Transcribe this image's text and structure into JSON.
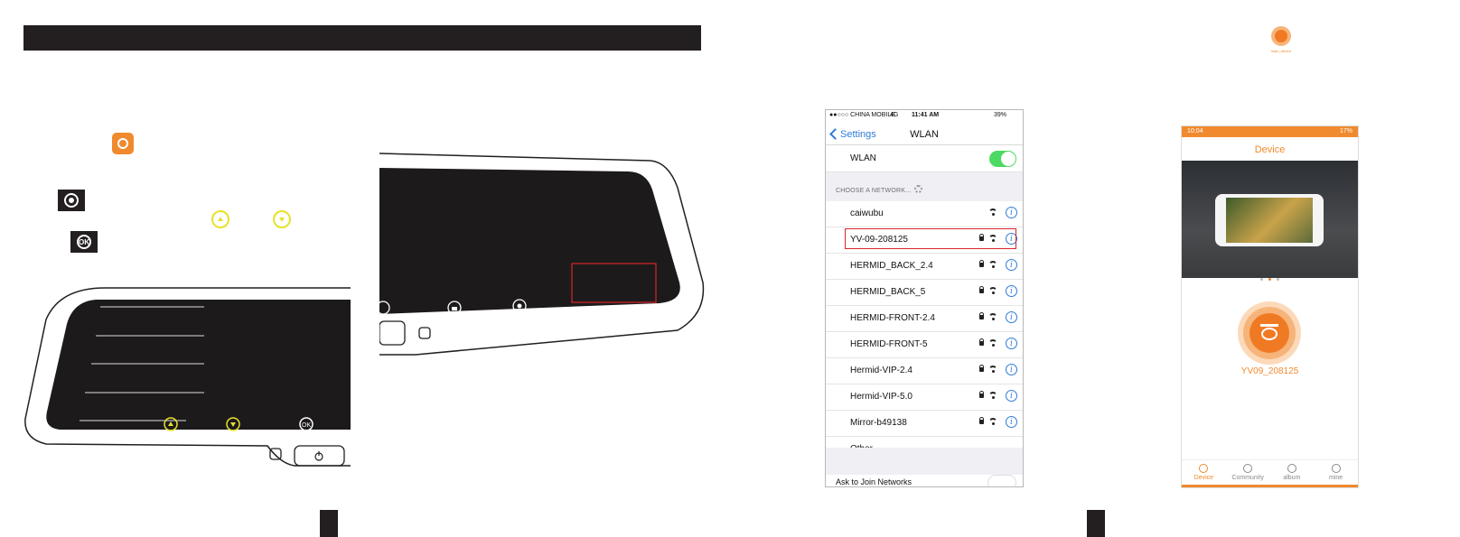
{
  "keys": {
    "ok_label": "OK"
  },
  "ios_settings": {
    "status": {
      "carrier": "●●○○○ CHINA MOBILE",
      "network": "4G",
      "time": "11:41 AM",
      "battery": "39%"
    },
    "back_label": "Settings",
    "title": "WLAN",
    "wlan_label": "WLAN",
    "section_header": "CHOOSE A NETWORK...",
    "networks": [
      {
        "name": "caiwubu",
        "locked": false,
        "highlighted": false
      },
      {
        "name": "YV-09-208125",
        "locked": true,
        "highlighted": true
      },
      {
        "name": "HERMID_BACK_2.4",
        "locked": true,
        "highlighted": false
      },
      {
        "name": "HERMID_BACK_5",
        "locked": true,
        "highlighted": false
      },
      {
        "name": "HERMID-FRONT-2.4",
        "locked": true,
        "highlighted": false
      },
      {
        "name": "HERMID-FRONT-5",
        "locked": true,
        "highlighted": false
      },
      {
        "name": "Hermid-VIP-2.4",
        "locked": true,
        "highlighted": false
      },
      {
        "name": "Hermid-VIP-5.0",
        "locked": true,
        "highlighted": false
      },
      {
        "name": "Mirror-b49138",
        "locked": true,
        "highlighted": false
      }
    ],
    "other_label": "Other...",
    "ask_join_label": "Ask to Join Networks"
  },
  "app": {
    "status_time": "10:04",
    "status_battery": "17%",
    "title": "Device",
    "device_name": "YV09_208125",
    "tabs": [
      {
        "label": "Device",
        "active": true
      },
      {
        "label": "Community",
        "active": false
      },
      {
        "label": "album",
        "active": false
      },
      {
        "label": "mine",
        "active": false
      }
    ],
    "accent_color": "#f08a2e"
  },
  "top_logo_text": "main_device"
}
